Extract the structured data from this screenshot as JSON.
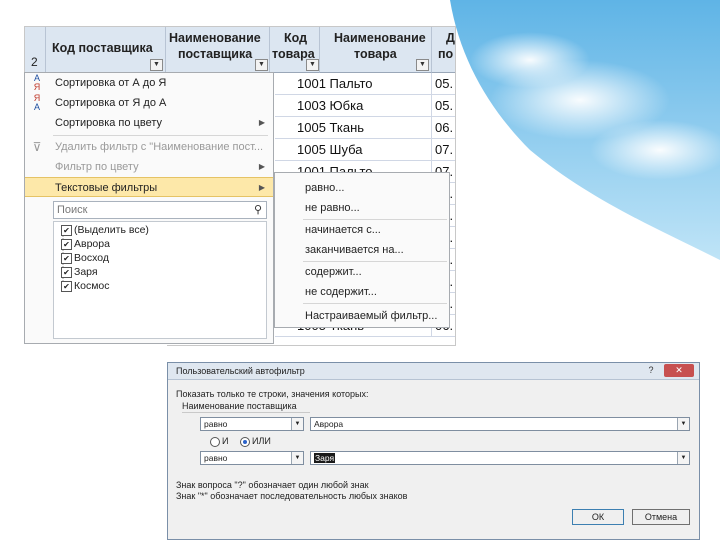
{
  "sheet": {
    "row_number": "2",
    "headers": [
      {
        "line1": "Код поставщика",
        "line2": ""
      },
      {
        "line1": "Наименование",
        "line2": "поставщика"
      },
      {
        "line1": "Код",
        "line2": "товара"
      },
      {
        "line1": "Наименование",
        "line2": "товара"
      },
      {
        "line1": "Д",
        "line2": "по"
      }
    ],
    "rows": [
      {
        "code": "1001",
        "name": "Пальто",
        "date": "05."
      },
      {
        "code": "1003",
        "name": "Юбка",
        "date": "05."
      },
      {
        "code": "1005",
        "name": "Ткань",
        "date": "06."
      },
      {
        "code": "1005",
        "name": "Шуба",
        "date": "07."
      },
      {
        "code": "1001",
        "name": "Пальто",
        "date": "07."
      },
      {
        "code": "1003",
        "name": "Пальто",
        "date": "07."
      },
      {
        "code": "",
        "name": "",
        "date": "07."
      },
      {
        "code": "",
        "name": "",
        "date": "07."
      },
      {
        "code": "",
        "name": "",
        "date": "06."
      },
      {
        "code": "",
        "name": "",
        "date": "06."
      },
      {
        "code": "",
        "name": "",
        "date": "06."
      },
      {
        "code": "1005",
        "name": "Ткань",
        "date": "06."
      }
    ]
  },
  "filter_menu": {
    "sort_asc": "Сортировка от А до Я",
    "sort_desc": "Сортировка от Я до А",
    "sort_color": "Сортировка по цвету",
    "clear_filter": "Удалить фильтр с \"Наименование пост...",
    "filter_color": "Фильтр по цвету",
    "text_filters": "Текстовые фильтры",
    "search_placeholder": "Поиск",
    "items": [
      {
        "label": "(Выделить все)",
        "checked": true
      },
      {
        "label": "Аврора",
        "checked": true
      },
      {
        "label": "Восход",
        "checked": true
      },
      {
        "label": "Заря",
        "checked": true
      },
      {
        "label": "Космос",
        "checked": true
      }
    ]
  },
  "text_filters_submenu": {
    "equals": "равно...",
    "not_equals": "не равно...",
    "begins_with": "начинается с...",
    "ends_with": "заканчивается на...",
    "contains": "содержит...",
    "not_contains": "не содержит...",
    "custom": "Настраиваемый фильтр..."
  },
  "dialog": {
    "title": "Пользовательский автофильтр",
    "help_btn": "?",
    "close_btn": "✕",
    "instruction": "Показать только те строки, значения которых:",
    "field_name": "Наименование поставщика",
    "cond1_op": "равно",
    "cond1_value": "Аврора",
    "radio_and": "И",
    "radio_or": "ИЛИ",
    "cond2_op": "равно",
    "cond2_value": "Заря",
    "hint1": "Знак вопроса \"?\" обозначает один любой знак",
    "hint2": "Знак \"*\" обозначает последовательность любых знаков",
    "ok": "ОК",
    "cancel": "Отмена"
  },
  "colors": {
    "header_bg": "#dce6f1",
    "menu_highlight": "#fde8a9",
    "dialog_bg": "#f0f0f0"
  }
}
